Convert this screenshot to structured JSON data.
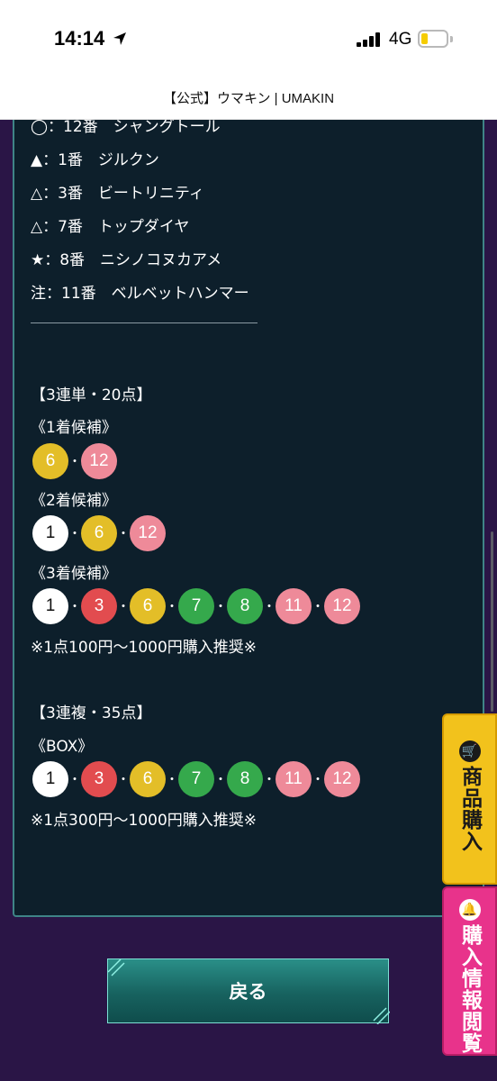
{
  "status_bar": {
    "time": "14:14",
    "network": "4G",
    "battery_level": 0.25
  },
  "browser": {
    "site_title": "【公式】ウマキン | UMAKIN"
  },
  "prediction": {
    "marks": [
      "◯：12番　シャングトール",
      "▲：1番　ジルクン",
      "△：3番　ビートリニティ",
      "△：7番　トップダイヤ",
      "★：8番　ニシノコヌカアメ",
      "注：11番　ベルベットハンマー"
    ]
  },
  "trifecta": {
    "header": "【3連単・20点】",
    "first_label": "《1着候補》",
    "first": [
      {
        "num": "6",
        "color": "yellow"
      },
      {
        "num": "12",
        "color": "pink"
      }
    ],
    "second_label": "《2着候補》",
    "second": [
      {
        "num": "1",
        "color": "white"
      },
      {
        "num": "6",
        "color": "yellow"
      },
      {
        "num": "12",
        "color": "pink"
      }
    ],
    "third_label": "《3着候補》",
    "third": [
      {
        "num": "1",
        "color": "white"
      },
      {
        "num": "3",
        "color": "red"
      },
      {
        "num": "6",
        "color": "yellow"
      },
      {
        "num": "7",
        "color": "green"
      },
      {
        "num": "8",
        "color": "green"
      },
      {
        "num": "11",
        "color": "pink"
      },
      {
        "num": "12",
        "color": "pink"
      }
    ],
    "note": "※1点100円～1000円購入推奨※"
  },
  "trio": {
    "header": "【3連複・35点】",
    "box_label": "《BOX》",
    "box": [
      {
        "num": "1",
        "color": "white"
      },
      {
        "num": "3",
        "color": "red"
      },
      {
        "num": "6",
        "color": "yellow"
      },
      {
        "num": "7",
        "color": "green"
      },
      {
        "num": "8",
        "color": "green"
      },
      {
        "num": "11",
        "color": "pink"
      },
      {
        "num": "12",
        "color": "pink"
      }
    ],
    "note": "※1点300円～1000円購入推奨※"
  },
  "back_button": "戻る",
  "side_tabs": {
    "buy": {
      "label": "商品購入",
      "icon": "cart-icon",
      "color": "#f2c21c"
    },
    "info": {
      "label": "購入情報閲覧",
      "icon": "bell-icon",
      "color": "#e8338b"
    }
  }
}
